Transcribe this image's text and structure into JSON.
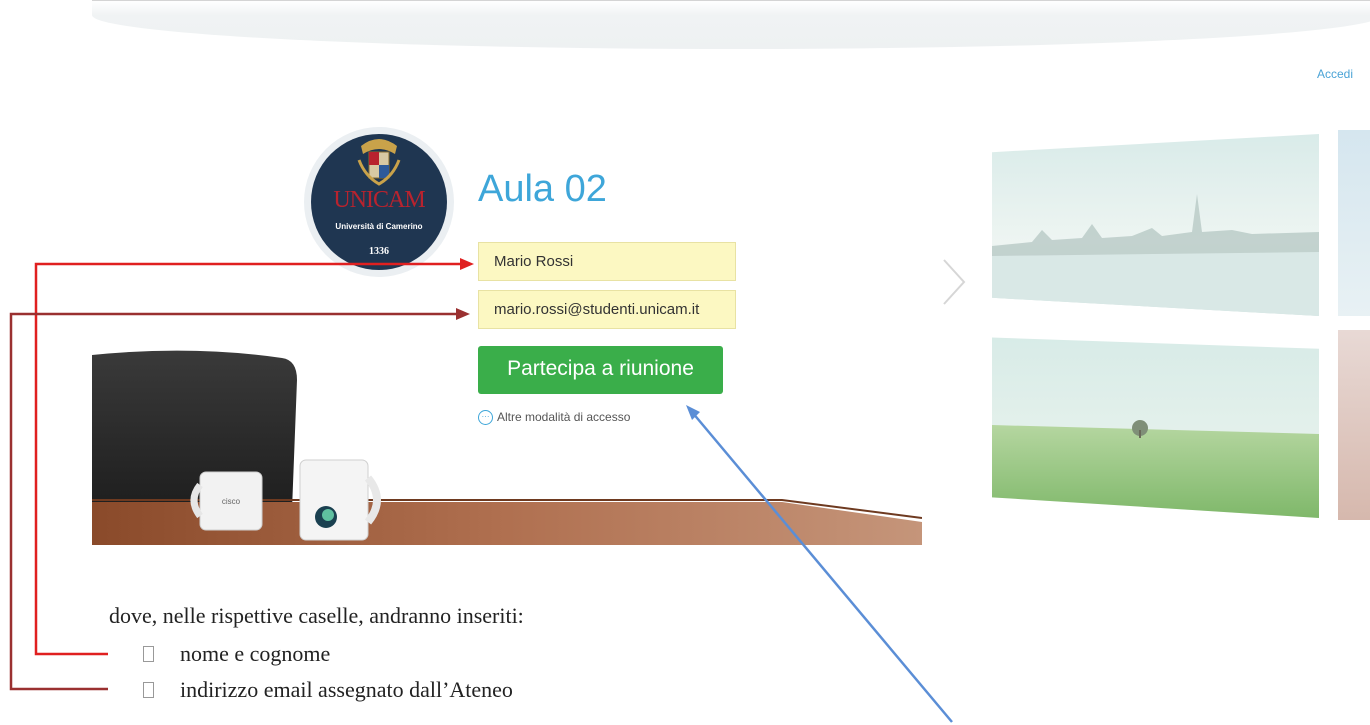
{
  "header": {
    "signin_label": "Accedi"
  },
  "logo": {
    "name": "UNICAM",
    "subtitle": "Università di Camerino",
    "year": "1336"
  },
  "meeting": {
    "room_title": "Aula 02",
    "name_value": "Mario Rossi",
    "email_value": "mario.rossi@studenti.unicam.it",
    "join_button": "Partecipa a riunione",
    "alt_access": "Altre modalità di accesso"
  },
  "instructions": {
    "caption": "dove, nelle rispettive caselle, andranno inseriti:",
    "items": [
      "nome e cognome",
      "indirizzo email assegnato dall’Ateneo"
    ]
  },
  "mug_logo": "cisco",
  "colors": {
    "accent": "#3ea6d9",
    "join": "#3aae4a",
    "field_bg": "#fcf8c2",
    "arrow_red": "#e02020",
    "arrow_darkred": "#9a3030",
    "arrow_blue": "#5b8ed6"
  }
}
